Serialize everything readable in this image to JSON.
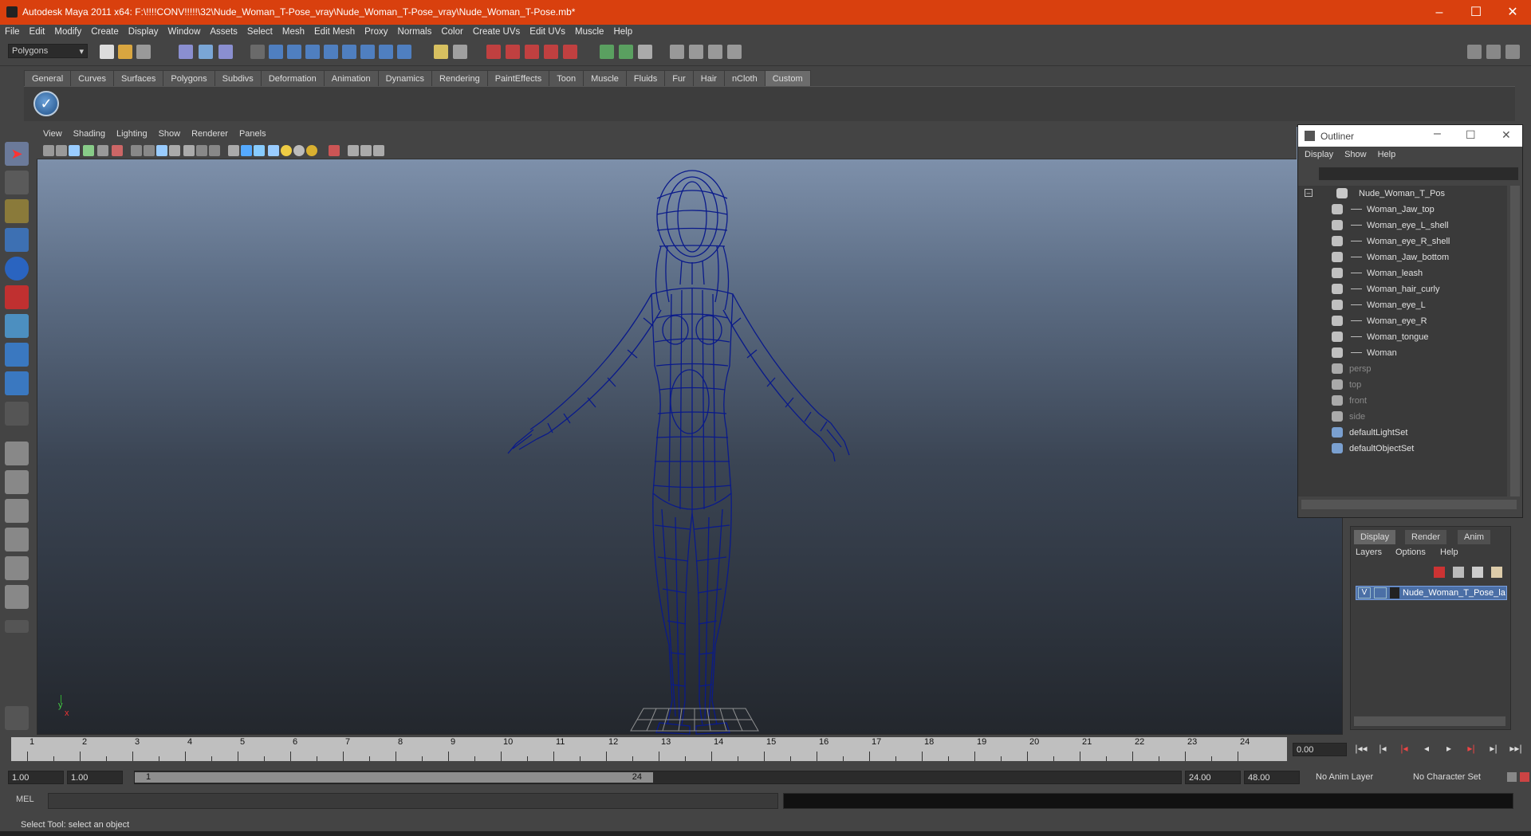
{
  "window": {
    "title": "Autodesk Maya 2011 x64: F:\\!!!!CONV!!!!!\\32\\Nude_Woman_T-Pose_vray\\Nude_Woman_T-Pose_vray\\Nude_Woman_T-Pose.mb*"
  },
  "menubar": [
    "File",
    "Edit",
    "Modify",
    "Create",
    "Display",
    "Window",
    "Assets",
    "Select",
    "Mesh",
    "Edit Mesh",
    "Proxy",
    "Normals",
    "Color",
    "Create UVs",
    "Edit UVs",
    "Muscle",
    "Help"
  ],
  "status": {
    "mode": "Polygons"
  },
  "shelf_tabs": [
    "General",
    "Curves",
    "Surfaces",
    "Polygons",
    "Subdivs",
    "Deformation",
    "Animation",
    "Dynamics",
    "Rendering",
    "PaintEffects",
    "Toon",
    "Muscle",
    "Fluids",
    "Fur",
    "Hair",
    "nCloth",
    "Custom"
  ],
  "shelf_active": "Custom",
  "viewport": {
    "menu": [
      "View",
      "Shading",
      "Lighting",
      "Show",
      "Renderer",
      "Panels"
    ],
    "axis_x": "x",
    "axis_y": "y"
  },
  "outliner": {
    "title": "Outliner",
    "menu": [
      "Display",
      "Show",
      "Help"
    ],
    "root": "Nude_Woman_T_Pos",
    "children": [
      "Woman_Jaw_top",
      "Woman_eye_L_shell",
      "Woman_eye_R_shell",
      "Woman_Jaw_bottom",
      "Woman_leash",
      "Woman_hair_curly",
      "Woman_eye_L",
      "Woman_eye_R",
      "Woman_tongue",
      "Woman"
    ],
    "cameras": [
      "persp",
      "top",
      "front",
      "side"
    ],
    "sets": [
      "defaultLightSet",
      "defaultObjectSet"
    ]
  },
  "layers": {
    "tabs": [
      "Display",
      "Render",
      "Anim"
    ],
    "menu": [
      "Layers",
      "Options",
      "Help"
    ],
    "visibility": "V",
    "layer_name": "Nude_Woman_T_Pose_la"
  },
  "timeline": {
    "ticks": [
      "1",
      "2",
      "3",
      "4",
      "5",
      "6",
      "7",
      "8",
      "9",
      "10",
      "11",
      "12",
      "13",
      "14",
      "15",
      "16",
      "17",
      "18",
      "19",
      "20",
      "21",
      "22",
      "23",
      "24"
    ],
    "current_time": "0.00"
  },
  "range": {
    "start": "1.00",
    "anim_start": "1.00",
    "knob_start": "1",
    "knob_end": "24",
    "anim_end": "24.00",
    "end": "48.00",
    "anim_layer": "No Anim Layer",
    "char_set": "No Character Set"
  },
  "cmd": {
    "label": "MEL"
  },
  "helpline": "Select Tool: select an object",
  "colors": {
    "titlebar": "#d9400e",
    "wireframe": "#0a1a8a",
    "selection": "#4b6fa6"
  },
  "icons": [
    "select-tool-icon",
    "lasso-icon",
    "paint-icon",
    "cone-icon",
    "sphere-icon",
    "scale-icon",
    "cube-icon",
    "move-icon",
    "rotate-icon"
  ]
}
